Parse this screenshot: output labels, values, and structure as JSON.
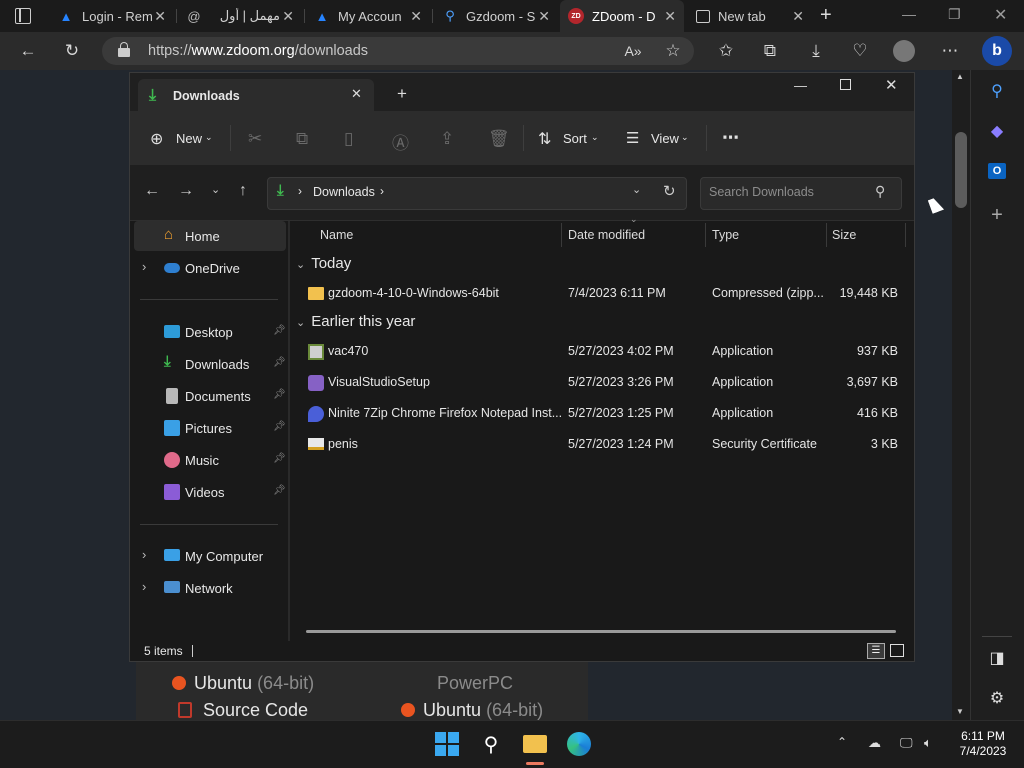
{
  "browser": {
    "tabs": [
      {
        "title": "Login - Rem",
        "icon": "atlassian-icon"
      },
      {
        "title": "مهمل | أول",
        "icon": "at-sign-icon"
      },
      {
        "title": "My Accoun",
        "icon": "atlassian-icon"
      },
      {
        "title": "Gzdoom - S",
        "icon": "search-icon"
      },
      {
        "title": "ZDoom - D",
        "icon": "zdoom-icon"
      },
      {
        "title": "New tab",
        "icon": "newtab-icon"
      }
    ],
    "url_prefix": "https://",
    "url_domain": "www.zdoom.org",
    "url_path": "/downloads"
  },
  "web": {
    "ubuntu1": "Ubuntu",
    "ubuntu1_arch": "(64-bit)",
    "powerpc": "PowerPC",
    "source": "Source Code",
    "ubuntu2": "Ubuntu",
    "ubuntu2_arch": "(64-bit)"
  },
  "explorer": {
    "tab_title": "Downloads",
    "toolbar": {
      "new": "New",
      "sort": "Sort",
      "view": "View"
    },
    "breadcrumb": "Downloads",
    "search_placeholder": "Search Downloads",
    "nav": {
      "home": "Home",
      "onedrive": "OneDrive",
      "desktop": "Desktop",
      "downloads": "Downloads",
      "documents": "Documents",
      "pictures": "Pictures",
      "music": "Music",
      "videos": "Videos",
      "mycomputer": "My Computer",
      "network": "Network"
    },
    "columns": {
      "name": "Name",
      "date": "Date modified",
      "type": "Type",
      "size": "Size"
    },
    "groups": {
      "today": "Today",
      "earlier": "Earlier this year"
    },
    "files": [
      {
        "name": "gzdoom-4-10-0-Windows-64bit",
        "date": "7/4/2023 6:11 PM",
        "type": "Compressed (zipp...",
        "size": "19,448 KB"
      },
      {
        "name": "vac470",
        "date": "5/27/2023 4:02 PM",
        "type": "Application",
        "size": "937 KB"
      },
      {
        "name": "VisualStudioSetup",
        "date": "5/27/2023 3:26 PM",
        "type": "Application",
        "size": "3,697 KB"
      },
      {
        "name": "Ninite 7Zip Chrome Firefox Notepad Inst...",
        "date": "5/27/2023 1:25 PM",
        "type": "Application",
        "size": "416 KB"
      },
      {
        "name": "penis",
        "date": "5/27/2023 1:24 PM",
        "type": "Security Certificate",
        "size": "3 KB"
      }
    ],
    "status": "5 items"
  },
  "taskbar": {
    "time": "6:11 PM",
    "date": "7/4/2023"
  },
  "colors": {
    "accent": "#0078d4",
    "folder": "#f2c14e",
    "download_green": "#3fb950"
  }
}
